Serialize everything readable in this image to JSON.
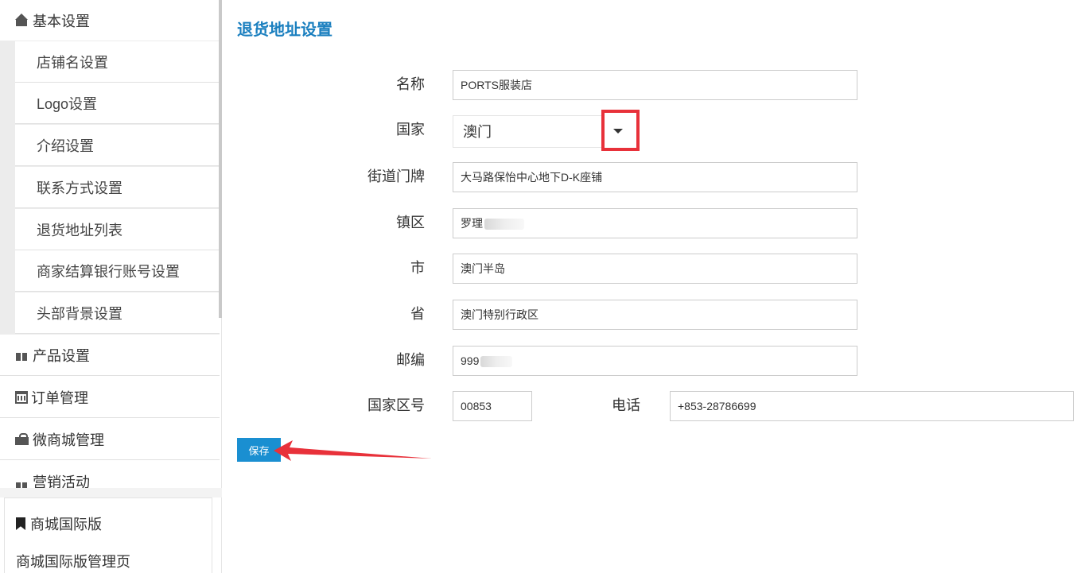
{
  "sidebar": {
    "basic": "基本设置",
    "sub_items": [
      "店铺名设置",
      "Logo设置",
      "介绍设置",
      "联系方式设置",
      "退货地址列表",
      "商家结算银行账号设置",
      "头部背景设置"
    ],
    "products": "产品设置",
    "orders": "订单管理",
    "wechat_mall": "微商城管理",
    "marketing": "营销活动",
    "intl_title": "商城国际版",
    "intl_link": "商城国际版管理页"
  },
  "page": {
    "title": "退货地址设置"
  },
  "form": {
    "name_label": "名称",
    "name_value": "PORTS服装店",
    "country_label": "国家",
    "country_value": "澳门",
    "street_label": "街道门牌",
    "street_value": "大马路保怡中心地下D-K座铺",
    "district_label": "镇区",
    "district_value": "罗理",
    "city_label": "市",
    "city_value": "澳门半岛",
    "province_label": "省",
    "province_value": "澳门特别行政区",
    "zip_label": "邮编",
    "zip_value": "999",
    "area_code_label": "国家区号",
    "area_code_value": "00853",
    "phone_label": "电话",
    "phone_value": "+853-28786699",
    "save_label": "保存"
  },
  "colors": {
    "accent": "#1a7fbf",
    "button": "#1a8fd1",
    "highlight": "#e8313a"
  }
}
